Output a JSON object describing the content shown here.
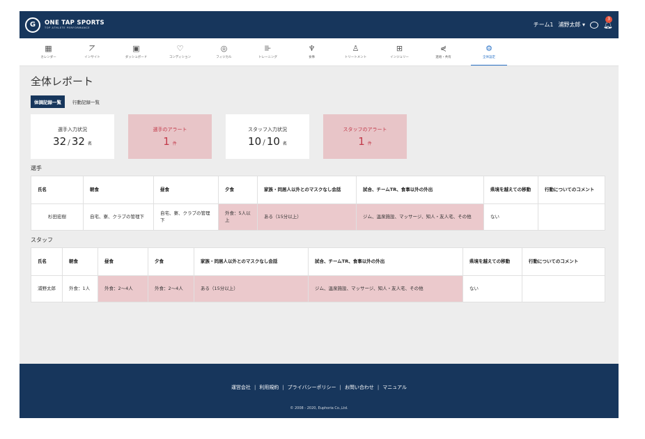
{
  "header": {
    "logo_mark": "G",
    "logo_name": "ONE TAP SPORTS",
    "logo_tagline": "TOP ATHLETE PERFORMANCE",
    "team": "チーム1",
    "user": "浦野太郎",
    "notification_count": "3"
  },
  "nav": [
    {
      "label": "カレンダー",
      "icon": "calendar-icon",
      "glyph": "▦"
    },
    {
      "label": "インサイト",
      "icon": "chart-icon",
      "glyph": "⦢"
    },
    {
      "label": "ダッシュボード",
      "icon": "dashboard-icon",
      "glyph": "▣"
    },
    {
      "label": "コンディション",
      "icon": "heart-icon",
      "glyph": "♡"
    },
    {
      "label": "フィジカル",
      "icon": "person-icon",
      "glyph": "◎"
    },
    {
      "label": "トレーニング",
      "icon": "dumbbell-icon",
      "glyph": "⊪"
    },
    {
      "label": "食事",
      "icon": "cutlery-icon",
      "glyph": "♆"
    },
    {
      "label": "トリートメント",
      "icon": "treatment-icon",
      "glyph": "♙"
    },
    {
      "label": "インジュリー",
      "icon": "medical-icon",
      "glyph": "⊞"
    },
    {
      "label": "連絡・共有",
      "icon": "share-icon",
      "glyph": "⋞"
    },
    {
      "label": "全体設定",
      "icon": "settings-icon",
      "glyph": "⚙"
    }
  ],
  "page": {
    "title": "全体レポート",
    "tabs": [
      {
        "label": "体調記録一覧"
      },
      {
        "label": "行動記録一覧"
      }
    ]
  },
  "cards": [
    {
      "label": "選手入力状況",
      "value": "32",
      "total": "32",
      "unit": "名"
    },
    {
      "label": "選手のアラート",
      "value": "1",
      "unit": "件"
    },
    {
      "label": "スタッフ入力状況",
      "value": "10",
      "total": "10",
      "unit": "名"
    },
    {
      "label": "スタッフのアラート",
      "value": "1",
      "unit": "件"
    }
  ],
  "players": {
    "title": "選手",
    "headers": [
      "氏名",
      "朝食",
      "昼食",
      "夕食",
      "家族・同居人以外とのマスクなし会話",
      "試合、チームTR、食事以外の外出",
      "県境を越えての移動",
      "行動についてのコメント"
    ],
    "rows": [
      {
        "cells": [
          "杉田宏樹",
          "自宅、寮、クラブの管理下",
          "自宅、寮、クラブの管理下",
          "外食：5人以上",
          "ある（15分以上）",
          "ジム、温泉施設、マッサージ、知人・友人宅、その他",
          "ない",
          ""
        ]
      }
    ]
  },
  "staff": {
    "title": "スタッフ",
    "headers": [
      "氏名",
      "朝食",
      "昼食",
      "夕食",
      "家族・同居人以外とのマスクなし会話",
      "試合、チームTR、食事以外の外出",
      "県境を越えての移動",
      "行動についてのコメント"
    ],
    "rows": [
      {
        "cells": [
          "浦野太郎",
          "外食：1人",
          "外食：2〜4人",
          "外食：2〜4人",
          "ある（15分以上）",
          "ジム、温泉施設、マッサージ、知人・友人宅、その他",
          "ない",
          ""
        ]
      }
    ]
  },
  "footer": {
    "links": [
      "運営会社",
      "利用規約",
      "プライバシーポリシー",
      "お問い合わせ",
      "マニュアル"
    ],
    "copyright": "© 2008 - 2020, Euphoria Co.,Ltd."
  }
}
